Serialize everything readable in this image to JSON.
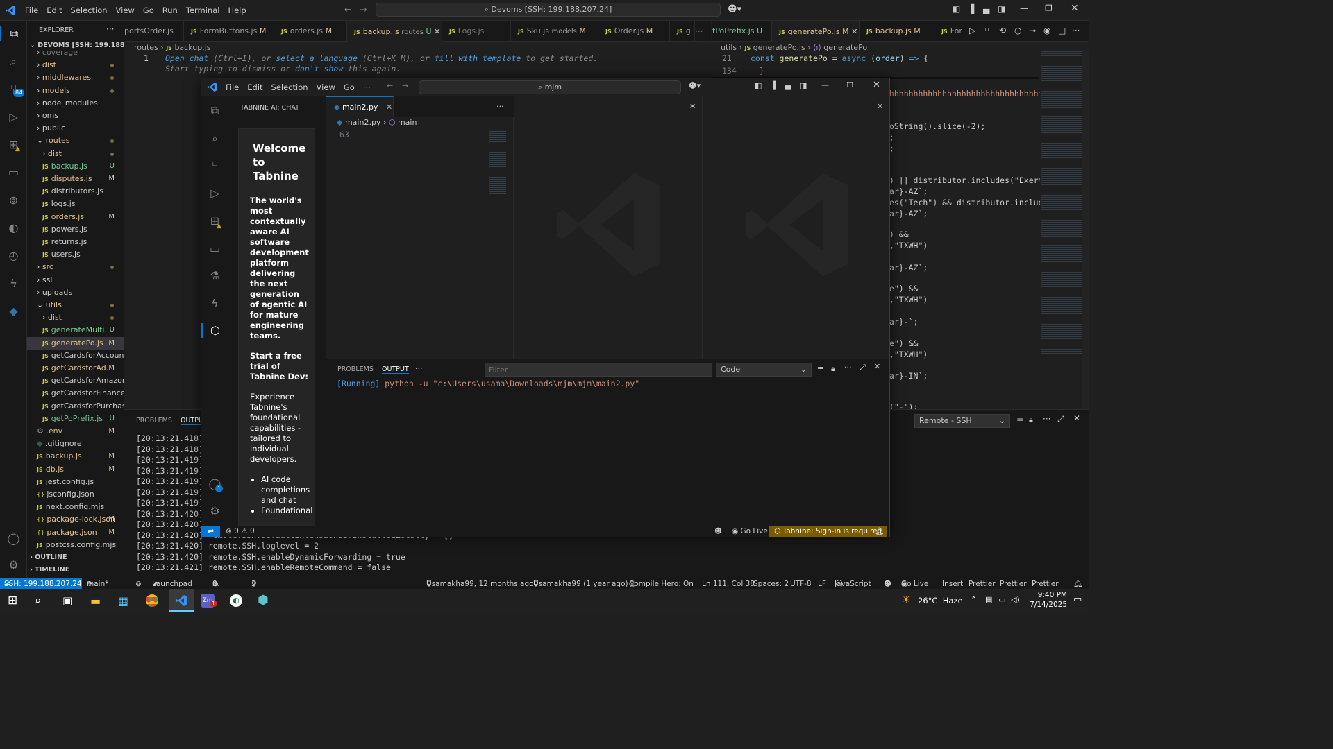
{
  "titlebar": {
    "menu": [
      "File",
      "Edit",
      "Selection",
      "View",
      "Go",
      "Run",
      "Terminal",
      "Help"
    ],
    "command_center": "Devoms [SSH: 199.188.207.24]"
  },
  "explorer": {
    "title": "EXPLORER",
    "root": "DEVOMS [SSH: 199.188.20...",
    "items": [
      {
        "label": "coverage",
        "kind": "folder"
      },
      {
        "label": "dist",
        "kind": "folder"
      },
      {
        "label": "middlewares",
        "kind": "folder"
      },
      {
        "label": "models",
        "kind": "folder"
      },
      {
        "label": "node_modules",
        "kind": "folder"
      },
      {
        "label": "oms",
        "kind": "folder"
      },
      {
        "label": "public",
        "kind": "folder"
      },
      {
        "label": "routes",
        "kind": "folder-open"
      },
      {
        "label": "dist",
        "kind": "folder"
      },
      {
        "label": "backup.js",
        "kind": "js",
        "badge": "U"
      },
      {
        "label": "disputes.js",
        "kind": "js",
        "badge": "M"
      },
      {
        "label": "distributors.js",
        "kind": "js"
      },
      {
        "label": "logs.js",
        "kind": "js"
      },
      {
        "label": "orders.js",
        "kind": "js",
        "badge": "M"
      },
      {
        "label": "powers.js",
        "kind": "js"
      },
      {
        "label": "returns.js",
        "kind": "js"
      },
      {
        "label": "users.js",
        "kind": "js"
      },
      {
        "label": "src",
        "kind": "folder"
      },
      {
        "label": "ssl",
        "kind": "folder"
      },
      {
        "label": "uploads",
        "kind": "folder"
      },
      {
        "label": "utils",
        "kind": "folder-open"
      },
      {
        "label": "dist",
        "kind": "folder"
      },
      {
        "label": "generateMulti...",
        "kind": "js",
        "badge": "U"
      },
      {
        "label": "generatePo.js",
        "kind": "js",
        "badge": "M"
      },
      {
        "label": "getCardsforAccount.js",
        "kind": "js"
      },
      {
        "label": "getCardsforAd...",
        "kind": "js",
        "badge": "M"
      },
      {
        "label": "getCardsforAmazon.js",
        "kind": "js"
      },
      {
        "label": "getCardsforFinance.js",
        "kind": "js"
      },
      {
        "label": "getCardsforPurchasi...",
        "kind": "js"
      },
      {
        "label": "getPoPrefix.js",
        "kind": "js",
        "badge": "U"
      },
      {
        "label": ".env",
        "kind": "gear",
        "badge": "M"
      },
      {
        "label": ".gitignore",
        "kind": "git"
      },
      {
        "label": "backup.js",
        "kind": "js",
        "badge": "M"
      },
      {
        "label": "db.js",
        "kind": "js",
        "badge": "M"
      },
      {
        "label": "jest.config.js",
        "kind": "js"
      },
      {
        "label": "jsconfig.json",
        "kind": "json"
      },
      {
        "label": "next.config.mjs",
        "kind": "js"
      },
      {
        "label": "package-lock.json",
        "kind": "json",
        "badge": "M"
      },
      {
        "label": "package.json",
        "kind": "json",
        "badge": "M"
      },
      {
        "label": "postcss.config.mjs",
        "kind": "js"
      }
    ],
    "outline": "OUTLINE",
    "timeline": "TIMELINE"
  },
  "tabs_left": [
    {
      "label": "portsOrder.js",
      "status": ""
    },
    {
      "label": "FormButtons.js",
      "status": "M"
    },
    {
      "label": "orders.js",
      "status": "M"
    },
    {
      "label": "backup.js",
      "desc": "routes",
      "status": "U"
    },
    {
      "label": "Logs.js",
      "status": ""
    },
    {
      "label": "Sku.js",
      "desc": "models",
      "status": "M"
    },
    {
      "label": "Order.js",
      "status": "M"
    },
    {
      "label": "g",
      "status": ""
    }
  ],
  "tabs_right": [
    {
      "label": "tPoPrefix.js",
      "status": "U"
    },
    {
      "label": "generatePo.js",
      "status": "M"
    },
    {
      "label": "backup.js",
      "status": "M"
    },
    {
      "label": "For",
      "status": ""
    }
  ],
  "editor_left": {
    "breadcrumb": [
      "routes",
      "backup.js"
    ],
    "line_no": "1",
    "hint1_parts": [
      "Open chat",
      " (Ctrl+I), or ",
      "select a language",
      " (Ctrl+K M), or ",
      "fill with template",
      " to get started."
    ],
    "hint2_parts": [
      "Start typing to dismiss or ",
      "don't show",
      " this again."
    ]
  },
  "editor_right": {
    "breadcrumb": [
      "utils",
      "generatePo.js",
      "generatePo"
    ],
    "line21_no": "21",
    "line21": "const generatePo = async (order) => {",
    "line134_no": "134",
    "line134": "}",
    "fragments": [
      "hhhhhhhhhhhhhhhhhhhhhhhhhhhhhhhhffffffff",
      "toString().slice(-2);",
      "1;",
      ");",
      "\") || distributor.includes(\"Exerti",
      "ear}-AZ`;",
      "des(\"Tech\") && distributor.include",
      "ear}-AZ`;",
      "\") &&",
      "\",\"TXWH\")",
      "ear}-AZ`;",
      "ce\") &&",
      "\",\"TXWH\")",
      "ear}-`;",
      "ce\") &&",
      "\",\"TXWH\")",
      "ear}-IN`;",
      "t(\"-\");"
    ]
  },
  "bottom_panel": {
    "tabs": [
      "PROBLEMS",
      "OUTPU"
    ],
    "lines": [
      "[20:13:21.418]",
      "[20:13:21.418]",
      "[20:13:21.419]",
      "[20:13:21.419]",
      "[20:13:21.419]",
      "[20:13:21.419]",
      "[20:13:21.419]",
      "[20:13:21.420]",
      "[20:13:21.420]",
      "[20:13:21.420] remote.SSH.defaultExtensionsIfInstalledLocally = []",
      "[20:13:21.420] remote.SSH.loglevel = 2",
      "[20:13:21.420] remote.SSH.enableDynamicForwarding = true",
      "[20:13:21.421] remote.SSH.enableRemoteCommand = false"
    ],
    "channel": "Remote - SSH"
  },
  "inner_window": {
    "menu": [
      "File",
      "Edit",
      "Selection",
      "View",
      "Go"
    ],
    "search": "mjm",
    "chat_title": "TABNINE AI: CHAT",
    "welcome_title": "Welcome to Tabnine",
    "welcome_lead": "The world's most contextually aware AI software development platform delivering the next generation of agentic AI for mature engineering teams.",
    "trial_title": "Start a free trial of Tabnine Dev:",
    "trial_text": "Experience Tabnine's foundational capabilities - tailored to individual developers.",
    "bullets": [
      "AI code completions and chat",
      "Foundational"
    ],
    "tab": "main2.py",
    "breadcrumb": [
      "main2.py",
      "main"
    ],
    "line_no": "63",
    "panel_tabs": [
      "PROBLEMS",
      "OUTPUT"
    ],
    "filter_placeholder": "Filter",
    "channel": "Code",
    "output_running": "[Running]",
    "output_cmd": "python -u \"c:\\Users\\usama\\Downloads\\mjm\\mjm\\main2.py\"",
    "status": {
      "errors": "0",
      "warnings": "0",
      "go_live": "Go Live",
      "tabnine": "Tabnine: Sign-in is required"
    },
    "accounts_badge": "1"
  },
  "statusbar": {
    "remote": "SSH: 199.188.207.24",
    "branch": "main*",
    "launchpad": "Launchpad",
    "errors": "0",
    "warnings": "0",
    "ports": "3",
    "blame1": "Usamakha99, 12 months ago",
    "blame2": "Usamakha99 (1 year ago)",
    "compile_hero": "Compile Hero: On",
    "position": "Ln 111, Col 38",
    "spaces": "Spaces: 2",
    "encoding": "UTF-8",
    "eol": "LF",
    "language": "JavaScript",
    "go_live": "Go Live",
    "insert": "Insert",
    "prettier1": "Prettier",
    "prettier2": "Prettier",
    "prettier3": "Prettier"
  },
  "source_control_badge": "84",
  "taskbar": {
    "weather": "26°C  Haze",
    "time": "9:40 PM",
    "date": "7/14/2025",
    "app_badge": "1"
  }
}
